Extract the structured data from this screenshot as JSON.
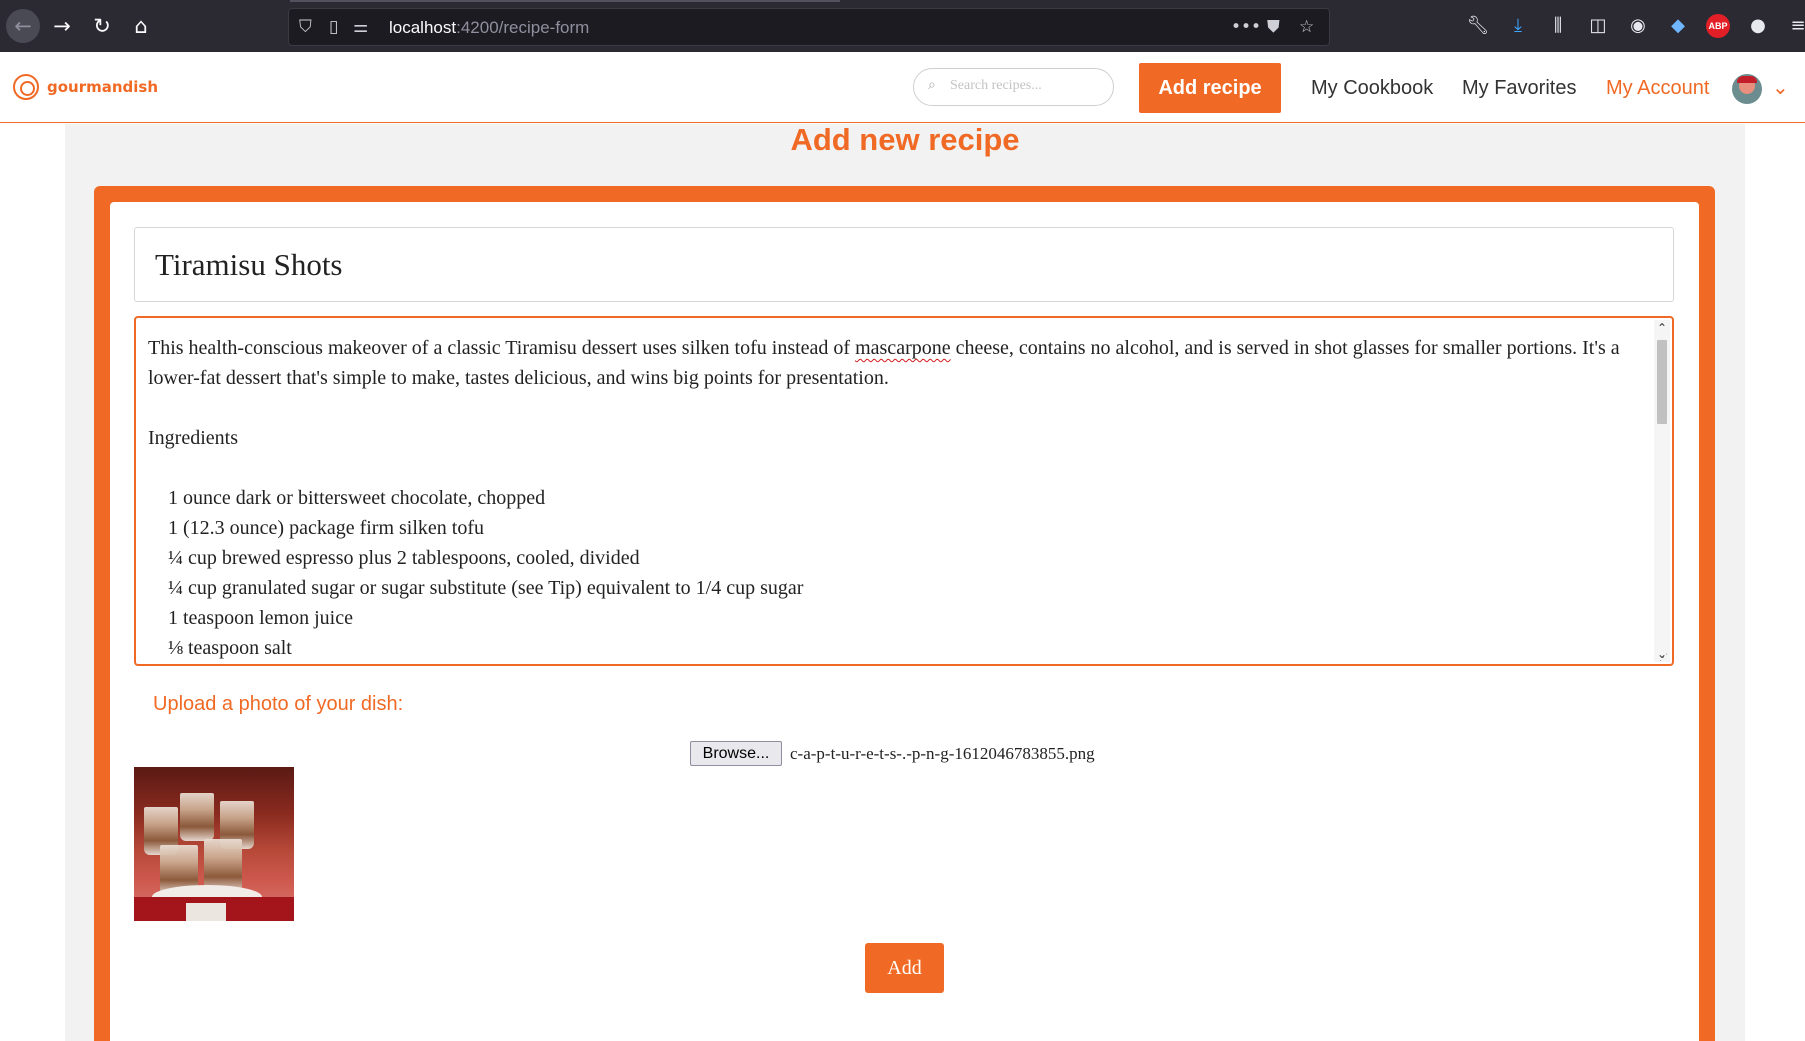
{
  "browser": {
    "url_host": "localhost",
    "url_path": ":4200/recipe-form"
  },
  "header": {
    "brand": "gourmandish",
    "search_placeholder": "Search recipes...",
    "add_recipe_label": "Add recipe",
    "nav": [
      "My Cookbook",
      "My Favorites",
      "My Account"
    ],
    "active_nav": "My Account"
  },
  "form": {
    "page_title": "Add new recipe",
    "recipe_title": "Tiramisu Shots",
    "description": {
      "intro_before": "This health-conscious makeover of a classic Tiramisu dessert uses silken tofu instead of ",
      "intro_misspelled": "mascarpone",
      "intro_after": " cheese, contains no alcohol, and is served in shot glasses for smaller portions. It's a lower-fat dessert that's simple to make, tastes delicious, and wins big points for presentation.",
      "ingredients_heading": "Ingredients",
      "ingredients": [
        "1 ounce dark or bittersweet chocolate, chopped",
        "1 (12.3 ounce) package firm silken tofu",
        "¼ cup brewed espresso plus 2 tablespoons, cooled, divided",
        "¼ cup granulated sugar or sugar substitute (see Tip) equivalent to 1/4 cup sugar",
        "1 teaspoon lemon juice",
        "⅛ teaspoon salt"
      ]
    },
    "upload_label": "Upload a photo of your dish:",
    "browse_label": "Browse...",
    "file_name": "c-a-p-t-u-r-e-t-s-.-p-n-g-1612046783855.png",
    "submit_label": "Add"
  },
  "colors": {
    "accent": "#f06a25",
    "browser_chrome": "#2b2a33",
    "page_background": "#f2f2f2"
  }
}
